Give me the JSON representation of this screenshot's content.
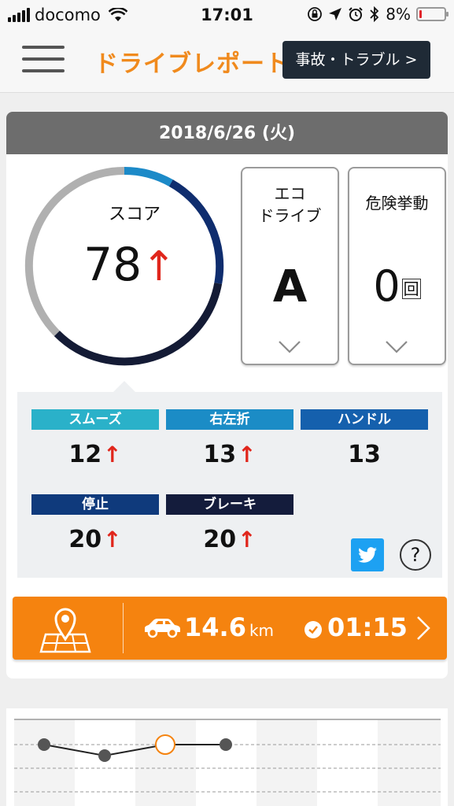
{
  "status_bar": {
    "carrier": "docomo",
    "time": "17:01",
    "battery": "8%",
    "battery_level": 0.08,
    "icons": [
      "signal-icon",
      "wifi-icon",
      "orientation-lock-icon",
      "location-icon",
      "alarm-icon",
      "bluetooth-icon",
      "battery-icon"
    ]
  },
  "header": {
    "menu_icon": "hamburger-icon",
    "title": "ドライブレポート",
    "trouble_button": "事故・トラブル >"
  },
  "report": {
    "date": "2018/6/26 (火)",
    "score": {
      "label": "スコア",
      "value": "78",
      "trend_icon": "up-arrow-icon",
      "gauge_fraction": 0.78
    },
    "eco_drive": {
      "title": "エコ\nドライブ",
      "title_line1": "エコ",
      "title_line2": "ドライブ",
      "value": "A",
      "expand_icon": "chevron-down-icon"
    },
    "danger": {
      "title": "危険挙動",
      "value": "0",
      "unit": "回",
      "expand_icon": "chevron-down-icon"
    },
    "metrics": [
      {
        "label": "スムーズ",
        "value": "12",
        "trend": "up",
        "color": "#2ab1c9"
      },
      {
        "label": "右左折",
        "value": "13",
        "trend": "up",
        "color": "#1b8cc6"
      },
      {
        "label": "ハンドル",
        "value": "13",
        "trend": "",
        "color": "#1560ad"
      },
      {
        "label": "停止",
        "value": "20",
        "trend": "up",
        "color": "#0f3a7c"
      },
      {
        "label": "ブレーキ",
        "value": "20",
        "trend": "up",
        "color": "#141c3c"
      }
    ],
    "trend_arrow": "↑",
    "share_icon": "twitter-icon",
    "help": {
      "icon": "help-icon",
      "symbol": "?"
    },
    "route": {
      "map_icon": "map-pin-icon",
      "car_icon": "car-icon",
      "distance": "14.6",
      "distance_unit": "km",
      "clock_icon": "clock-icon",
      "duration": "01:15",
      "next_icon": "chevron-right-icon"
    }
  },
  "colors": {
    "accent_orange": "#f5830f",
    "title_orange": "#f08a1d",
    "trend_up": "#e0261c",
    "gauge_gray": "#b0b0b0",
    "gauge_mid": "#1c8ac8",
    "gauge_dark": "#0f2d6e",
    "gauge_navy": "#141b35"
  },
  "history_chart": {
    "points": [
      {
        "index": 0,
        "value": 2,
        "highlighted": false
      },
      {
        "index": 1,
        "value": 1,
        "highlighted": false
      },
      {
        "index": 2,
        "value": 2,
        "highlighted": true
      },
      {
        "index": 3,
        "value": 2,
        "highlighted": false
      }
    ]
  }
}
